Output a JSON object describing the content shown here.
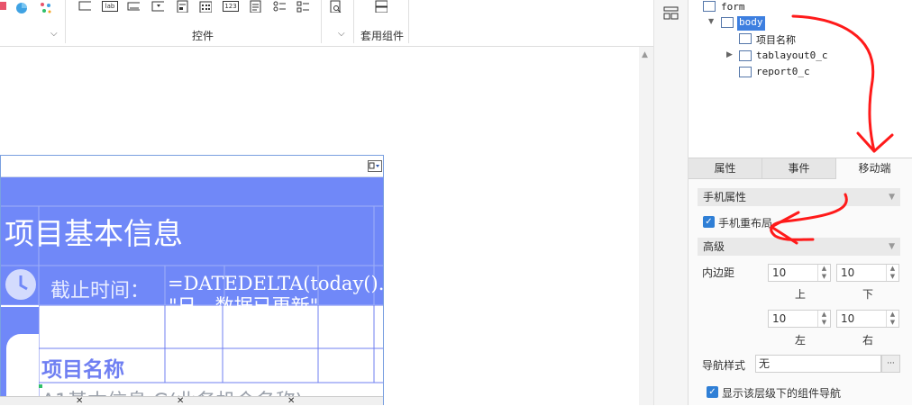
{
  "toolbar": {
    "group_controls_label": "控件",
    "group_combo_label": "套用组件",
    "text_icon_label": "lab",
    "num_icon_label": "123"
  },
  "canvas": {
    "title_text": "项目基本信息",
    "deadline_label": "截止时间：",
    "formula_text": "=DATEDELTA(today().",
    "formula_text2": "\"日，数据已更新\"",
    "cell_header": "项目名称",
    "cell_partial": "A1基本信息 G(业务机会名称)"
  },
  "tree": {
    "items": [
      "form",
      "body",
      "项目名称",
      "tablayout0_c",
      "report0_c"
    ]
  },
  "tabs": [
    "属性",
    "事件",
    "移动端"
  ],
  "panel": {
    "section_mobile": "手机属性",
    "checkbox_relayout": "手机重布局",
    "section_advanced": "高级",
    "padding_label": "内边距",
    "pad_top": "10",
    "pad_bottom": "10",
    "pad_left": "10",
    "pad_right": "10",
    "label_top": "上",
    "label_bottom": "下",
    "label_left": "左",
    "label_right": "右",
    "nav_style_label": "导航样式",
    "nav_style_value": "无",
    "nav_more": "···",
    "checkbox_nav": "显示该层级下的组件导航"
  },
  "colors": {
    "accent": "#7088f8",
    "annotation": "#ff1a1a",
    "checkbox": "#2f7fd6"
  }
}
